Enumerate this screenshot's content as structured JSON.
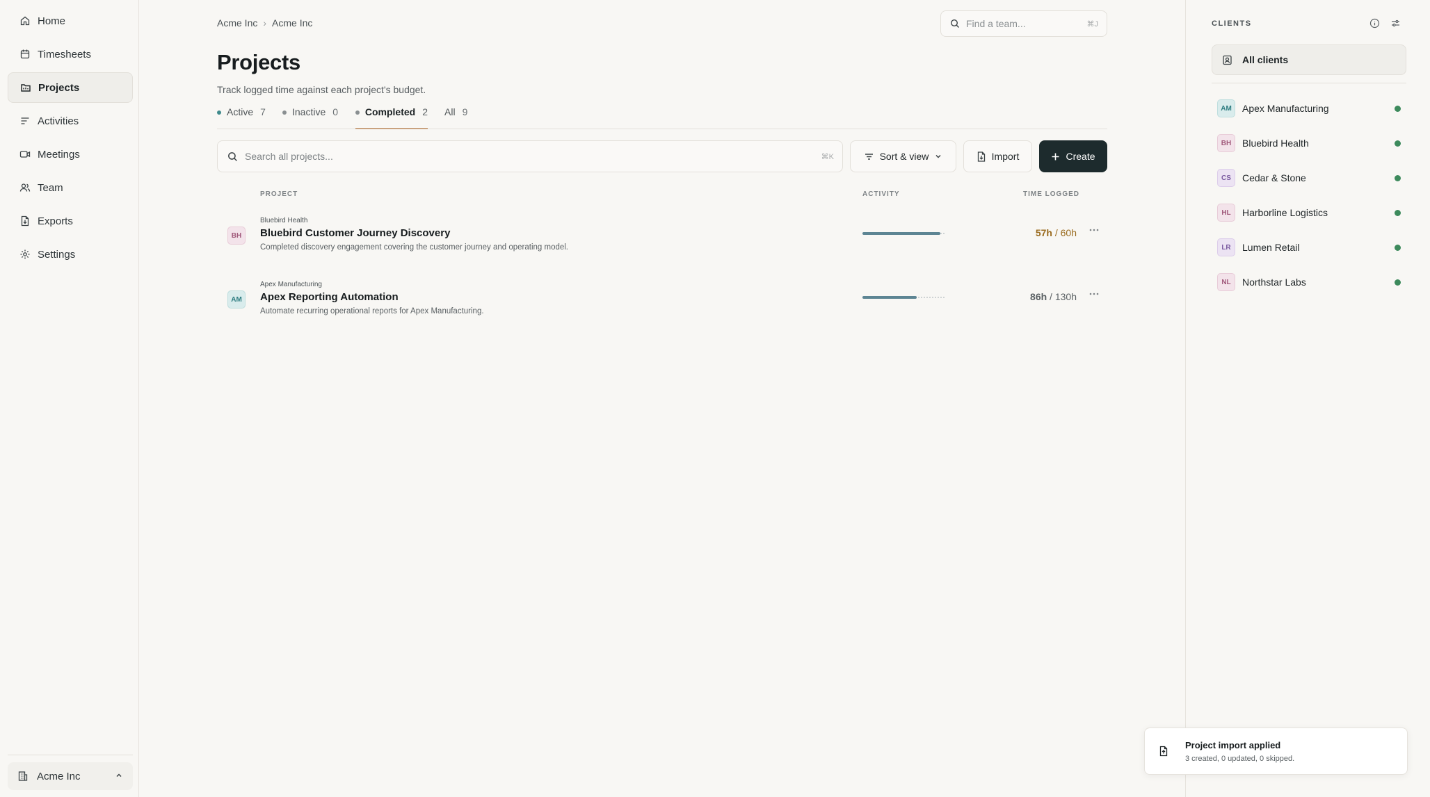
{
  "sidebar": {
    "items": [
      {
        "label": "Home",
        "icon": "home-icon",
        "active": false
      },
      {
        "label": "Timesheets",
        "icon": "calendar-icon",
        "active": false
      },
      {
        "label": "Projects",
        "icon": "folder-icon",
        "active": true
      },
      {
        "label": "Activities",
        "icon": "list-icon",
        "active": false
      },
      {
        "label": "Meetings",
        "icon": "video-icon",
        "active": false
      },
      {
        "label": "Team",
        "icon": "users-icon",
        "active": false
      },
      {
        "label": "Exports",
        "icon": "file-export-icon",
        "active": false
      },
      {
        "label": "Settings",
        "icon": "gear-icon",
        "active": false
      }
    ],
    "org": {
      "label": "Acme Inc",
      "icon": "building-icon"
    }
  },
  "breadcrumb": {
    "items": [
      "Acme Inc",
      "Acme Inc"
    ],
    "separator": "›"
  },
  "team_search": {
    "placeholder": "Find a team...",
    "shortcut": "⌘J"
  },
  "page": {
    "title": "Projects",
    "subtitle": "Track logged time against each project's budget."
  },
  "tabs": [
    {
      "label": "Active",
      "count": "7",
      "dot_color": "#3f8a8c",
      "active": false
    },
    {
      "label": "Inactive",
      "count": "0",
      "dot_color": "#8a8f91",
      "active": false
    },
    {
      "label": "Completed",
      "count": "2",
      "dot_color": "#8a8f91",
      "active": true
    },
    {
      "label": "All",
      "count": "9",
      "dot_color": null,
      "active": false
    }
  ],
  "toolbar": {
    "search_placeholder": "Search all projects...",
    "search_shortcut": "⌘K",
    "sort_label": "Sort & view",
    "import_label": "Import",
    "create_label": "Create"
  },
  "table": {
    "headers": {
      "project": "PROJECT",
      "activity": "ACTIVITY",
      "time": "TIME LOGGED"
    },
    "rows": [
      {
        "initials": "BH",
        "client": "Bluebird Health",
        "name": "Bluebird Customer Journey Discovery",
        "description": "Completed discovery engagement covering the customer journey and operating model.",
        "progress": 0.95,
        "logged": "57h",
        "budget": "60h",
        "time_color": "#9a6b1e",
        "avatar_bg": "#f3e3ea",
        "avatar_fg": "#a0587a"
      },
      {
        "initials": "AM",
        "client": "Apex Manufacturing",
        "name": "Apex Reporting Automation",
        "description": "Automate recurring operational reports for Apex Manufacturing.",
        "progress": 0.66,
        "logged": "86h",
        "budget": "130h",
        "time_color": "#5a6063",
        "avatar_bg": "#d9ecec",
        "avatar_fg": "#2d7c80"
      }
    ]
  },
  "clients": {
    "title": "CLIENTS",
    "all_label": "All clients",
    "items": [
      {
        "initials": "AM",
        "name": "Apex Manufacturing",
        "bg": "#d9ecec",
        "fg": "#2d7c80"
      },
      {
        "initials": "BH",
        "name": "Bluebird Health",
        "bg": "#f3e3ea",
        "fg": "#a0587a"
      },
      {
        "initials": "CS",
        "name": "Cedar & Stone",
        "bg": "#ece3f3",
        "fg": "#7a5aa0"
      },
      {
        "initials": "HL",
        "name": "Harborline Logistics",
        "bg": "#f3e3ea",
        "fg": "#a0587a"
      },
      {
        "initials": "LR",
        "name": "Lumen Retail",
        "bg": "#ece3f3",
        "fg": "#7a5aa0"
      },
      {
        "initials": "NL",
        "name": "Northstar Labs",
        "bg": "#f3e3ea",
        "fg": "#a0587a"
      }
    ],
    "status_color": "#3d8a5c"
  },
  "toast": {
    "title": "Project import applied",
    "message": "3 created, 0 updated, 0 skipped."
  }
}
